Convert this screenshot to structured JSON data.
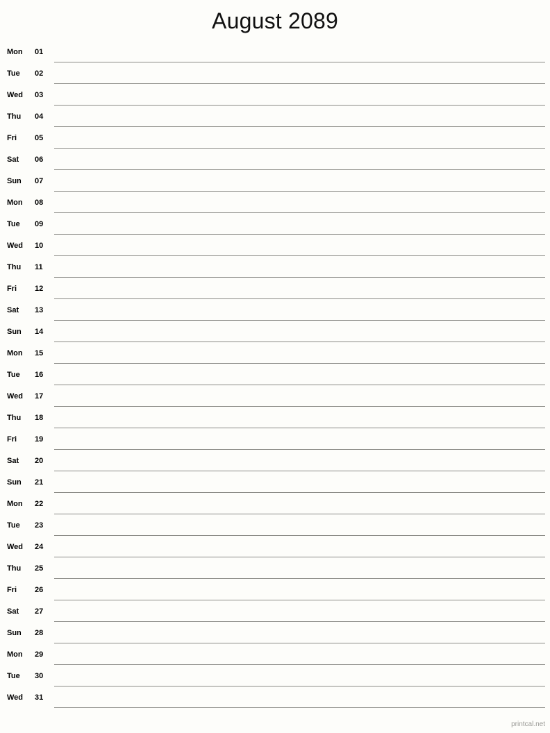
{
  "document": {
    "title": "August 2089",
    "month": "August",
    "year": "2089",
    "type": "printable-notes-calendar",
    "line_color": "#8a8a85",
    "background_color": "#fdfdfa",
    "text_color": "#000000"
  },
  "days": [
    {
      "weekday": "Mon",
      "number": "01"
    },
    {
      "weekday": "Tue",
      "number": "02"
    },
    {
      "weekday": "Wed",
      "number": "03"
    },
    {
      "weekday": "Thu",
      "number": "04"
    },
    {
      "weekday": "Fri",
      "number": "05"
    },
    {
      "weekday": "Sat",
      "number": "06"
    },
    {
      "weekday": "Sun",
      "number": "07"
    },
    {
      "weekday": "Mon",
      "number": "08"
    },
    {
      "weekday": "Tue",
      "number": "09"
    },
    {
      "weekday": "Wed",
      "number": "10"
    },
    {
      "weekday": "Thu",
      "number": "11"
    },
    {
      "weekday": "Fri",
      "number": "12"
    },
    {
      "weekday": "Sat",
      "number": "13"
    },
    {
      "weekday": "Sun",
      "number": "14"
    },
    {
      "weekday": "Mon",
      "number": "15"
    },
    {
      "weekday": "Tue",
      "number": "16"
    },
    {
      "weekday": "Wed",
      "number": "17"
    },
    {
      "weekday": "Thu",
      "number": "18"
    },
    {
      "weekday": "Fri",
      "number": "19"
    },
    {
      "weekday": "Sat",
      "number": "20"
    },
    {
      "weekday": "Sun",
      "number": "21"
    },
    {
      "weekday": "Mon",
      "number": "22"
    },
    {
      "weekday": "Tue",
      "number": "23"
    },
    {
      "weekday": "Wed",
      "number": "24"
    },
    {
      "weekday": "Thu",
      "number": "25"
    },
    {
      "weekday": "Fri",
      "number": "26"
    },
    {
      "weekday": "Sat",
      "number": "27"
    },
    {
      "weekday": "Sun",
      "number": "28"
    },
    {
      "weekday": "Mon",
      "number": "29"
    },
    {
      "weekday": "Tue",
      "number": "30"
    },
    {
      "weekday": "Wed",
      "number": "31"
    }
  ],
  "footer": {
    "credit": "printcal.net"
  }
}
